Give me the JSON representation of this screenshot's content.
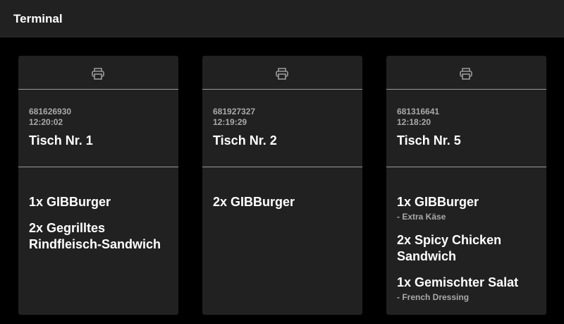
{
  "app": {
    "title": "Terminal"
  },
  "icons": {
    "print": "printer-icon"
  },
  "colors": {
    "background": "#000000",
    "card": "#212121",
    "titlebar": "#212121",
    "text": "#ffffff",
    "muted": "#a9a9a9",
    "divider": "#9a9a9a"
  },
  "orders": [
    {
      "id": "681626930",
      "time": "12:20:02",
      "table": "Tisch Nr. 1",
      "items": [
        {
          "name": "1x GIBBurger",
          "note": ""
        },
        {
          "name": "2x Gegrilltes Rindfleisch-Sandwich",
          "note": ""
        }
      ]
    },
    {
      "id": "681927327",
      "time": "12:19:29",
      "table": "Tisch Nr. 2",
      "items": [
        {
          "name": "2x GIBBurger",
          "note": ""
        }
      ]
    },
    {
      "id": "681316641",
      "time": "12:18:20",
      "table": "Tisch Nr. 5",
      "items": [
        {
          "name": "1x GIBBurger",
          "note": "- Extra Käse"
        },
        {
          "name": "2x Spicy Chicken Sandwich",
          "note": ""
        },
        {
          "name": "1x Gemischter Salat",
          "note": "- French Dressing"
        }
      ]
    }
  ]
}
